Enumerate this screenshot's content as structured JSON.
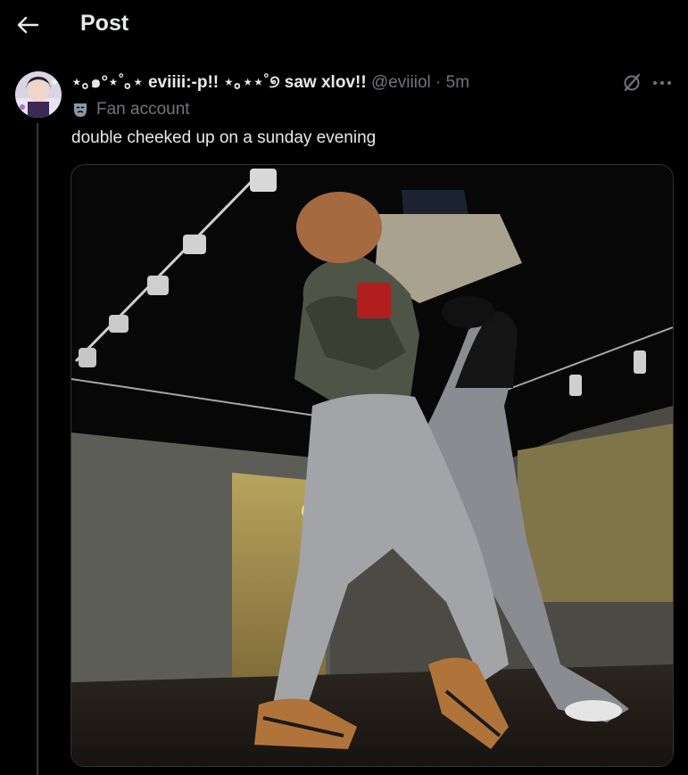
{
  "header": {
    "title": "Post",
    "back_icon": "arrow-left-icon"
  },
  "post": {
    "display_name": "⋆｡๑°⋆˚｡⋆ eviiii:-p!! ⋆｡⋆⋆˚୭ saw xlov!!",
    "handle": "@eviiiol",
    "separator": "·",
    "time": "5m",
    "account_label": "Fan account",
    "label_icon": "theater-mask-icon",
    "text": "double cheeked up on a sunday evening",
    "actions": {
      "grok_icon": "grok-icon",
      "more_icon": "more-horizontal-icon"
    },
    "media": {
      "type": "video-still",
      "icon": "dance-studio-image"
    }
  },
  "colors": {
    "background": "#000000",
    "primary_text": "#e7e9ea",
    "secondary_text": "#71767b",
    "border": "#2f3336"
  }
}
